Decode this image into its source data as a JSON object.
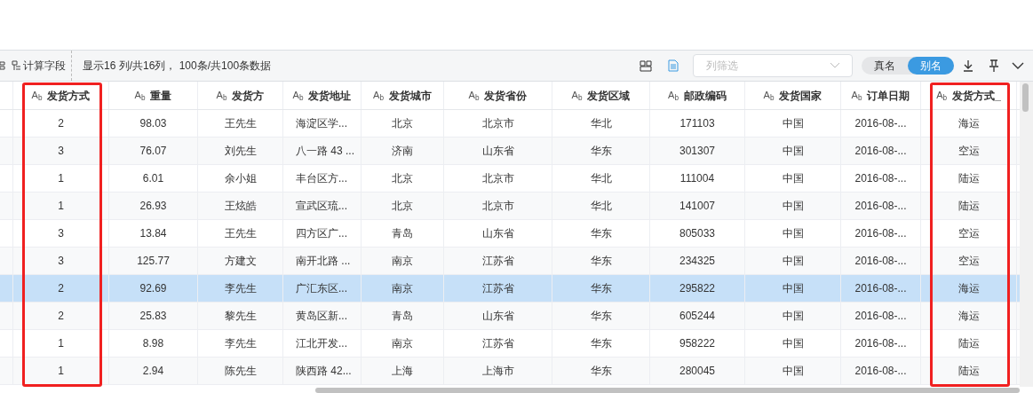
{
  "toolbar": {
    "calc_field": "计算字段",
    "summary": "显示16 列/共16列， 100条/共100条数据",
    "filter": {
      "placeholder": "列筛选"
    },
    "name_toggle": [
      {
        "label": "真名",
        "selected": false
      },
      {
        "label": "别名",
        "selected": true
      }
    ]
  },
  "table": {
    "columns": [
      {
        "label": "发货方式",
        "type_badge": "A$_{b}$",
        "highlighted": true
      },
      {
        "label": "重量",
        "type_badge": "A$_{b}$",
        "highlighted": false
      },
      {
        "label": "发货方",
        "type_badge": "A$_{b}$",
        "highlighted": false
      },
      {
        "label": "发货地址",
        "type_badge": "A$_{b}$",
        "highlighted": false
      },
      {
        "label": "发货城市",
        "type_badge": "A$_{b}$",
        "highlighted": false
      },
      {
        "label": "发货省份",
        "type_badge": "A$_{b}$",
        "highlighted": false
      },
      {
        "label": "发货区域",
        "type_badge": "A$_{b}$",
        "highlighted": false
      },
      {
        "label": "邮政编码",
        "type_badge": "A$_{b}$",
        "highlighted": false
      },
      {
        "label": "发货国家",
        "type_badge": "A$_{b}$",
        "highlighted": false
      },
      {
        "label": "订单日期",
        "type_badge": "A$_{b}$",
        "highlighted": false
      },
      {
        "label": "发货方式_",
        "type_badge": "A$_{b}$",
        "highlighted": true
      }
    ],
    "rows": [
      {
        "selected": false,
        "cells": [
          "2",
          "98.03",
          "王先生",
          "海淀区学...",
          "北京",
          "北京市",
          "华北",
          "171103",
          "中国",
          "2016-08-...",
          "海运"
        ]
      },
      {
        "selected": false,
        "cells": [
          "3",
          "76.07",
          "刘先生",
          "八一路 43 ...",
          "济南",
          "山东省",
          "华东",
          "301307",
          "中国",
          "2016-08-...",
          "空运"
        ]
      },
      {
        "selected": false,
        "cells": [
          "1",
          "6.01",
          "余小姐",
          "丰台区方...",
          "北京",
          "北京市",
          "华北",
          "111004",
          "中国",
          "2016-08-...",
          "陆运"
        ]
      },
      {
        "selected": false,
        "cells": [
          "1",
          "26.93",
          "王炫皓",
          "宣武区琉...",
          "北京",
          "北京市",
          "华北",
          "141007",
          "中国",
          "2016-08-...",
          "陆运"
        ]
      },
      {
        "selected": false,
        "cells": [
          "3",
          "13.84",
          "王先生",
          "四方区广...",
          "青岛",
          "山东省",
          "华东",
          "805033",
          "中国",
          "2016-08-...",
          "空运"
        ]
      },
      {
        "selected": false,
        "cells": [
          "3",
          "125.77",
          "方建文",
          "南开北路 ...",
          "南京",
          "江苏省",
          "华东",
          "234325",
          "中国",
          "2016-08-...",
          "空运"
        ]
      },
      {
        "selected": true,
        "cells": [
          "2",
          "92.69",
          "李先生",
          "广汇东区...",
          "南京",
          "江苏省",
          "华东",
          "295822",
          "中国",
          "2016-08-...",
          "海运"
        ]
      },
      {
        "selected": false,
        "cells": [
          "2",
          "25.83",
          "黎先生",
          "黄岛区新...",
          "青岛",
          "山东省",
          "华东",
          "605244",
          "中国",
          "2016-08-...",
          "海运"
        ]
      },
      {
        "selected": false,
        "cells": [
          "1",
          "8.98",
          "李先生",
          "江北开发...",
          "南京",
          "江苏省",
          "华东",
          "958222",
          "中国",
          "2016-08-...",
          "陆运"
        ]
      },
      {
        "selected": false,
        "cells": [
          "1",
          "2.94",
          "陈先生",
          "陕西路 42...",
          "上海",
          "上海市",
          "华东",
          "280045",
          "中国",
          "2016-08-...",
          "陆运"
        ]
      }
    ]
  }
}
